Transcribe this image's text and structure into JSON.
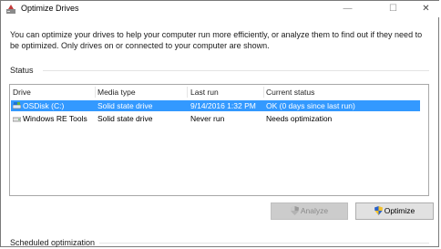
{
  "window": {
    "title": "Optimize Drives",
    "controls": {
      "minimize": "—",
      "maximize": "☐",
      "close": "✕"
    }
  },
  "description": "You can optimize your drives to help your computer run more efficiently, or analyze them to find out if they need to be optimized. Only drives on or connected to your computer are shown.",
  "status": {
    "label": "Status",
    "columns": [
      "Drive",
      "Media type",
      "Last run",
      "Current status"
    ],
    "rows": [
      {
        "drive": "OSDisk (C:)",
        "media": "Solid state drive",
        "last_run": "9/14/2016 1:32 PM",
        "status": "OK (0 days since last run)",
        "selected": true
      },
      {
        "drive": "Windows RE Tools",
        "media": "Solid state drive",
        "last_run": "Never run",
        "status": "Needs optimization",
        "selected": false
      }
    ]
  },
  "buttons": {
    "analyze": "Analyze",
    "optimize": "Optimize"
  },
  "scheduled": {
    "label": "Scheduled optimization"
  },
  "colors": {
    "selection": "#3399ff",
    "disabled_button": "#cccccc"
  }
}
